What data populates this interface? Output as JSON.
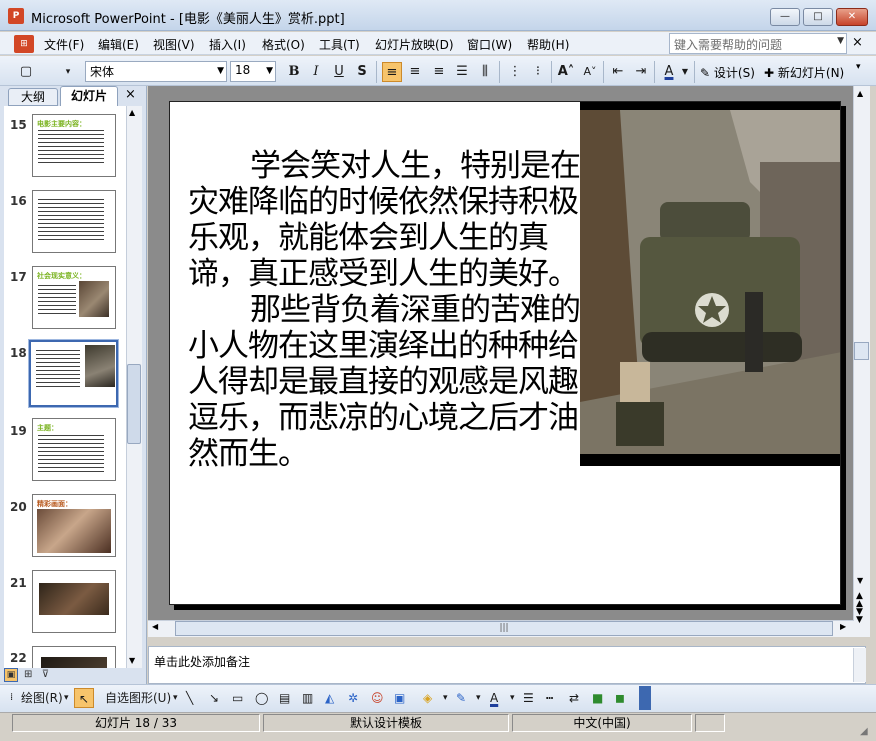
{
  "window": {
    "app_icon": "P",
    "title": "Microsoft PowerPoint - [电影《美丽人生》赏析.ppt]",
    "buttons": {
      "minimize": "—",
      "maximize": "□",
      "close": "✕"
    }
  },
  "menu": {
    "items": [
      "文件(F)",
      "编辑(E)",
      "视图(V)",
      "插入(I)",
      "格式(O)",
      "工具(T)",
      "幻灯片放映(D)",
      "窗口(W)",
      "帮助(H)"
    ],
    "help_placeholder": "键入需要帮助的问题",
    "close": "×"
  },
  "toolbar": {
    "font_name": "宋体",
    "font_size": "18",
    "bold": "B",
    "italic": "I",
    "underline": "U",
    "shadow": "S",
    "design_label": "设计(S)",
    "new_slide_label": "新幻灯片(N)"
  },
  "sidebar": {
    "tab_outline": "大纲",
    "tab_slides": "幻灯片",
    "close": "×",
    "thumbnails": [
      {
        "number": "15",
        "title": "电影主要内容："
      },
      {
        "number": "16",
        "title": ""
      },
      {
        "number": "17",
        "title": "社会现实意义："
      },
      {
        "number": "18",
        "title": ""
      },
      {
        "number": "19",
        "title": "主题："
      },
      {
        "number": "20",
        "title": "精彩画面："
      },
      {
        "number": "21",
        "title": ""
      },
      {
        "number": "22",
        "title": ""
      }
    ],
    "selected": "18"
  },
  "slide": {
    "paragraphs": [
      "学会笑对人生，特别是在灾难降临的时候依然保持积极乐观，就能体会到人生的真谛，真正感受到人生的美好。",
      "那些背负着深重的苦难的小人物在这里演绎出的种种给人得却是最直接的观感是风趣逗乐，而悲凉的心境之后才油然而生。"
    ]
  },
  "notes": {
    "placeholder": "单击此处添加备注"
  },
  "drawing_toolbar": {
    "draw_label": "绘图(R)",
    "autoshapes_label": "自选图形(U)"
  },
  "status": {
    "slide_indicator": "幻灯片 18 / 33",
    "template": "默认设计模板",
    "language": "中文(中国)"
  },
  "colors": {
    "accent": "#3d68b0",
    "thumb_title": "#7ab320",
    "selected_button": "#f7c46b"
  }
}
